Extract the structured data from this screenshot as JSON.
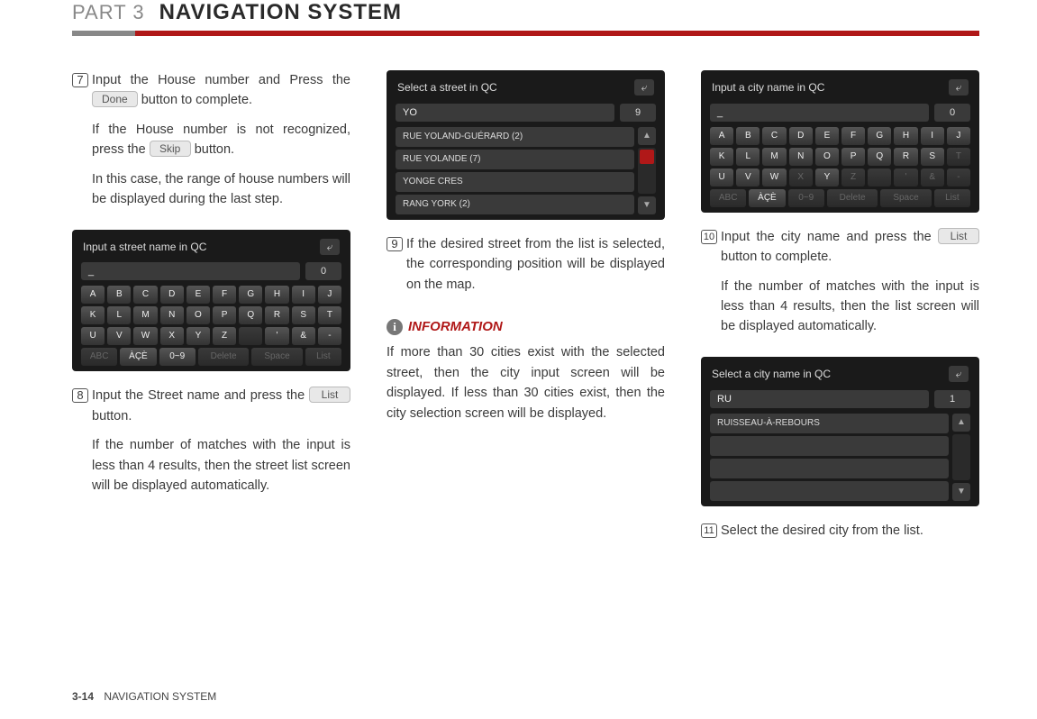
{
  "header": {
    "part": "PART 3",
    "title": "NAVIGATION SYSTEM"
  },
  "footer": {
    "page": "3-14",
    "section": "NAVIGATION SYSTEM"
  },
  "buttons": {
    "done": "Done",
    "skip": "Skip",
    "list": "List"
  },
  "steps": {
    "s7": {
      "num": "7",
      "p1a": "Input the House number and Press the ",
      "p1b": " button to complete.",
      "p2a": "If the House number is not recognized, press the ",
      "p2b": " button.",
      "p3": "In this case, the range of house numbers will be displayed during the last step."
    },
    "s8": {
      "num": "8",
      "p1a": "Input the Street name and press the ",
      "p1b": " button.",
      "p2": "If the number of matches with the input is less than 4 results, then the street list screen will be displayed automatically."
    },
    "s9": {
      "num": "9",
      "p1": "If the desired street from the list is selected, the corresponding position will be displayed on the map."
    },
    "s10": {
      "num": "10",
      "p1a": "Input the city name and press the ",
      "p1b": " button to complete.",
      "p2": "If the number of matches with the input is less than 4 results, then the list screen will be displayed automatically."
    },
    "s11": {
      "num": "11",
      "p1": "Select the desired city from the list."
    }
  },
  "info": {
    "label": "INFORMATION",
    "body": "If more than 30 cities exist with the selected street, then the city input screen will be displayed. If less than 30 cities exist, then the city selection screen will be displayed."
  },
  "dev1": {
    "title": "Input a street name in QC",
    "val": "_",
    "count": "0",
    "row1": [
      "A",
      "B",
      "C",
      "D",
      "E",
      "F",
      "G",
      "H",
      "I",
      "J"
    ],
    "row2": [
      "K",
      "L",
      "M",
      "N",
      "O",
      "P",
      "Q",
      "R",
      "S",
      "T"
    ],
    "row3": [
      "U",
      "V",
      "W",
      "X",
      "Y",
      "Z",
      "",
      ".",
      "'",
      "&",
      "-"
    ],
    "bottom": [
      "ABC",
      "ÀÇÈ",
      "0~9",
      "Delete",
      "Space",
      "List"
    ]
  },
  "dev2": {
    "title": "Select a street in QC",
    "val": "YO",
    "count": "9",
    "items": [
      "RUE YOLAND-GUÉRARD (2)",
      "RUE YOLANDE (7)",
      "YONGE CRES",
      "RANG YORK (2)"
    ]
  },
  "dev3": {
    "title": "Input a city name in QC",
    "val": "_",
    "count": "0",
    "row1": [
      "A",
      "B",
      "C",
      "D",
      "E",
      "F",
      "G",
      "H",
      "I",
      "J"
    ],
    "row2": [
      "K",
      "L",
      "M",
      "N",
      "O",
      "P",
      "Q",
      "R",
      "S",
      "T"
    ],
    "row3": [
      "U",
      "V",
      "W",
      "X",
      "Y",
      "Z",
      "",
      ".",
      "'",
      "&",
      "-"
    ],
    "bottom": [
      "ABC",
      "ÀÇÈ",
      "0~9",
      "Delete",
      "Space",
      "List"
    ]
  },
  "dev4": {
    "title": "Select a city name in QC",
    "val": "RU",
    "count": "1",
    "items": [
      "RUISSEAU-À-REBOURS",
      "",
      "",
      ""
    ]
  }
}
